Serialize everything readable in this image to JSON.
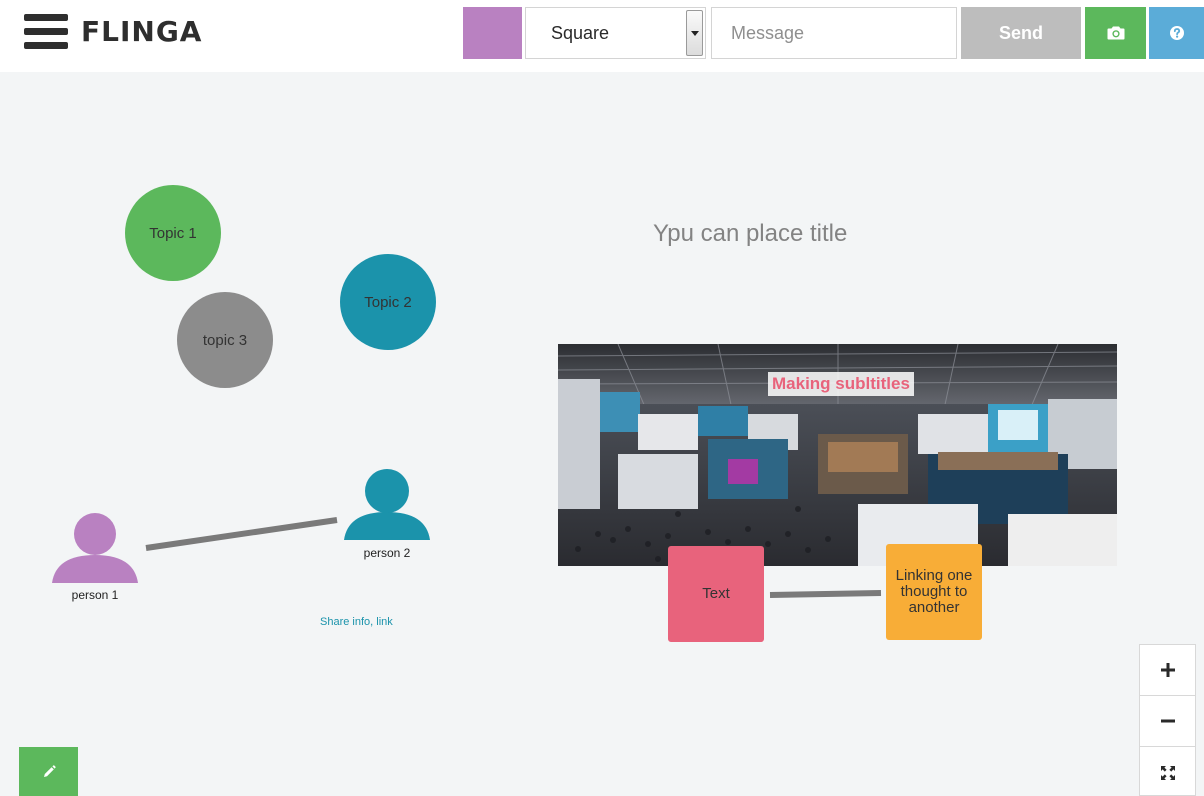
{
  "app": {
    "logo": "FLINGA"
  },
  "toolbar": {
    "color_swatch": "#b981c1",
    "shape_select": "Square",
    "message_placeholder": "Message",
    "send_label": "Send",
    "camera_icon": "camera-icon",
    "help_icon": "question-icon"
  },
  "canvas": {
    "title": "Ypu can place title",
    "topics": [
      {
        "label": "Topic 1",
        "color": "#5cb85c"
      },
      {
        "label": "Topic 2",
        "color": "#1b93ab"
      },
      {
        "label": "topic 3",
        "color": "#8c8c8c"
      }
    ],
    "persons": [
      {
        "label": "person 1",
        "color": "#b981c1"
      },
      {
        "label": "person 2",
        "color": "#1b93ab"
      }
    ],
    "share_link": "Share info, link",
    "photo_caption": "Making subltitles",
    "notes": [
      {
        "label": "Text",
        "color": "#e8637c"
      },
      {
        "label": "Linking one thought to another",
        "color": "#f8ad37"
      }
    ],
    "connector_color": "#7a7a7a"
  },
  "controls": {
    "zoom_in": "+",
    "zoom_out": "−",
    "fit_icon": "expand-icon",
    "edit_icon": "pencil-icon"
  }
}
